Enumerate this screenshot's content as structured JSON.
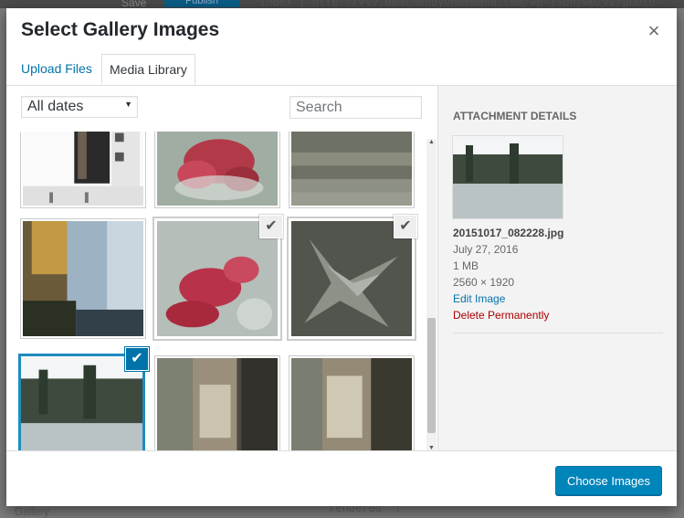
{
  "background": {
    "save_label": "Save",
    "publish_label": "Publish",
    "code_text": "Index | http://vvv.beachbodyondemand.com/wp-json/wp/v2/photo-",
    "bottom_left_text": "Gallery",
    "bottom_mid_text": "rendered\" :"
  },
  "modal": {
    "title": "Select Gallery Images",
    "close_glyph": "×",
    "tabs": {
      "upload": "Upload Files",
      "library": "Media Library"
    },
    "filter": {
      "selected": "All dates",
      "caret": "▼"
    },
    "search": {
      "placeholder": "Search",
      "value": ""
    },
    "check_glyph": "✔",
    "scroll_up_glyph": "▲",
    "scroll_down_glyph": "▼"
  },
  "attachment": {
    "heading": "Attachment Details",
    "filename": "20151017_082228.jpg",
    "date": "July 27, 2016",
    "size": "1 MB",
    "dimensions": "2560 × 1920",
    "edit_label": "Edit Image",
    "delete_label": "Delete Permanently"
  },
  "footer": {
    "choose_label": "Choose Images"
  },
  "colors": {
    "accent": "#0073aa",
    "selected_border": "#1e8cbe",
    "delete": "#aa0000"
  }
}
